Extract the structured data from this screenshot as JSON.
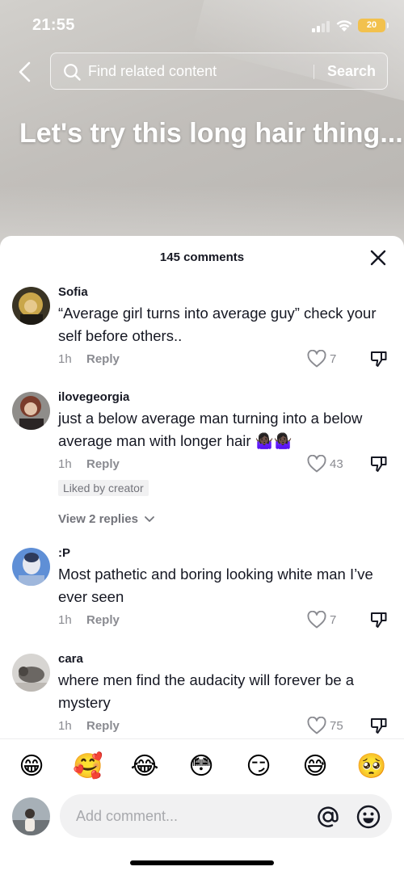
{
  "status_bar": {
    "time": "21:55",
    "battery": "20"
  },
  "search": {
    "placeholder": "Find related content",
    "button_label": "Search"
  },
  "video": {
    "caption": "Let's try this long hair thing..."
  },
  "comments_header": {
    "count_label": "145 comments"
  },
  "comments": [
    {
      "username": "Sofia",
      "text": "“Average girl turns into average guy” check your self before others..",
      "time": "1h",
      "reply_label": "Reply",
      "likes": "7",
      "avatar_icon": "avatar-sofia"
    },
    {
      "username": "ilovegeorgia",
      "text": "just a below average man turning into a below average man with longer hair 🤷🏿‍♀️🤷🏿‍♀️",
      "time": "1h",
      "reply_label": "Reply",
      "likes": "43",
      "badge": "Liked by creator",
      "view_replies": "View 2 replies",
      "avatar_icon": "avatar-ilovegeorgia"
    },
    {
      "username": ":P",
      "text": "Most pathetic and boring looking white man I’ve ever seen",
      "time": "1h",
      "reply_label": "Reply",
      "likes": "7",
      "avatar_icon": "avatar-p"
    },
    {
      "username": "cara",
      "text": "where men find the audacity will forever be a mystery",
      "time": "1h",
      "reply_label": "Reply",
      "likes": "75",
      "avatar_icon": "avatar-cara"
    }
  ],
  "emoji_bar": [
    "😁",
    "🥰",
    "😂",
    "😳",
    "😏",
    "😅",
    "🥺"
  ],
  "composer": {
    "placeholder": "Add comment...",
    "mention_symbol": "@"
  },
  "colors": {
    "text": "#161823",
    "secondary": "#8a8b91",
    "battery": "#f2c14e"
  }
}
